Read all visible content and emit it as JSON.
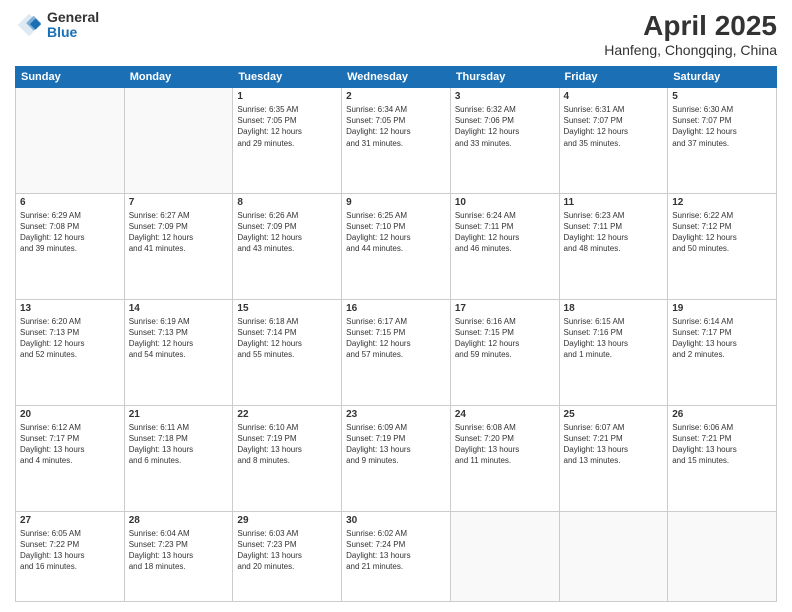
{
  "logo": {
    "general": "General",
    "blue": "Blue"
  },
  "header": {
    "month": "April 2025",
    "location": "Hanfeng, Chongqing, China"
  },
  "weekdays": [
    "Sunday",
    "Monday",
    "Tuesday",
    "Wednesday",
    "Thursday",
    "Friday",
    "Saturday"
  ],
  "weeks": [
    [
      {
        "day": "",
        "info": ""
      },
      {
        "day": "",
        "info": ""
      },
      {
        "day": "1",
        "info": "Sunrise: 6:35 AM\nSunset: 7:05 PM\nDaylight: 12 hours\nand 29 minutes."
      },
      {
        "day": "2",
        "info": "Sunrise: 6:34 AM\nSunset: 7:05 PM\nDaylight: 12 hours\nand 31 minutes."
      },
      {
        "day": "3",
        "info": "Sunrise: 6:32 AM\nSunset: 7:06 PM\nDaylight: 12 hours\nand 33 minutes."
      },
      {
        "day": "4",
        "info": "Sunrise: 6:31 AM\nSunset: 7:07 PM\nDaylight: 12 hours\nand 35 minutes."
      },
      {
        "day": "5",
        "info": "Sunrise: 6:30 AM\nSunset: 7:07 PM\nDaylight: 12 hours\nand 37 minutes."
      }
    ],
    [
      {
        "day": "6",
        "info": "Sunrise: 6:29 AM\nSunset: 7:08 PM\nDaylight: 12 hours\nand 39 minutes."
      },
      {
        "day": "7",
        "info": "Sunrise: 6:27 AM\nSunset: 7:09 PM\nDaylight: 12 hours\nand 41 minutes."
      },
      {
        "day": "8",
        "info": "Sunrise: 6:26 AM\nSunset: 7:09 PM\nDaylight: 12 hours\nand 43 minutes."
      },
      {
        "day": "9",
        "info": "Sunrise: 6:25 AM\nSunset: 7:10 PM\nDaylight: 12 hours\nand 44 minutes."
      },
      {
        "day": "10",
        "info": "Sunrise: 6:24 AM\nSunset: 7:11 PM\nDaylight: 12 hours\nand 46 minutes."
      },
      {
        "day": "11",
        "info": "Sunrise: 6:23 AM\nSunset: 7:11 PM\nDaylight: 12 hours\nand 48 minutes."
      },
      {
        "day": "12",
        "info": "Sunrise: 6:22 AM\nSunset: 7:12 PM\nDaylight: 12 hours\nand 50 minutes."
      }
    ],
    [
      {
        "day": "13",
        "info": "Sunrise: 6:20 AM\nSunset: 7:13 PM\nDaylight: 12 hours\nand 52 minutes."
      },
      {
        "day": "14",
        "info": "Sunrise: 6:19 AM\nSunset: 7:13 PM\nDaylight: 12 hours\nand 54 minutes."
      },
      {
        "day": "15",
        "info": "Sunrise: 6:18 AM\nSunset: 7:14 PM\nDaylight: 12 hours\nand 55 minutes."
      },
      {
        "day": "16",
        "info": "Sunrise: 6:17 AM\nSunset: 7:15 PM\nDaylight: 12 hours\nand 57 minutes."
      },
      {
        "day": "17",
        "info": "Sunrise: 6:16 AM\nSunset: 7:15 PM\nDaylight: 12 hours\nand 59 minutes."
      },
      {
        "day": "18",
        "info": "Sunrise: 6:15 AM\nSunset: 7:16 PM\nDaylight: 13 hours\nand 1 minute."
      },
      {
        "day": "19",
        "info": "Sunrise: 6:14 AM\nSunset: 7:17 PM\nDaylight: 13 hours\nand 2 minutes."
      }
    ],
    [
      {
        "day": "20",
        "info": "Sunrise: 6:12 AM\nSunset: 7:17 PM\nDaylight: 13 hours\nand 4 minutes."
      },
      {
        "day": "21",
        "info": "Sunrise: 6:11 AM\nSunset: 7:18 PM\nDaylight: 13 hours\nand 6 minutes."
      },
      {
        "day": "22",
        "info": "Sunrise: 6:10 AM\nSunset: 7:19 PM\nDaylight: 13 hours\nand 8 minutes."
      },
      {
        "day": "23",
        "info": "Sunrise: 6:09 AM\nSunset: 7:19 PM\nDaylight: 13 hours\nand 9 minutes."
      },
      {
        "day": "24",
        "info": "Sunrise: 6:08 AM\nSunset: 7:20 PM\nDaylight: 13 hours\nand 11 minutes."
      },
      {
        "day": "25",
        "info": "Sunrise: 6:07 AM\nSunset: 7:21 PM\nDaylight: 13 hours\nand 13 minutes."
      },
      {
        "day": "26",
        "info": "Sunrise: 6:06 AM\nSunset: 7:21 PM\nDaylight: 13 hours\nand 15 minutes."
      }
    ],
    [
      {
        "day": "27",
        "info": "Sunrise: 6:05 AM\nSunset: 7:22 PM\nDaylight: 13 hours\nand 16 minutes."
      },
      {
        "day": "28",
        "info": "Sunrise: 6:04 AM\nSunset: 7:23 PM\nDaylight: 13 hours\nand 18 minutes."
      },
      {
        "day": "29",
        "info": "Sunrise: 6:03 AM\nSunset: 7:23 PM\nDaylight: 13 hours\nand 20 minutes."
      },
      {
        "day": "30",
        "info": "Sunrise: 6:02 AM\nSunset: 7:24 PM\nDaylight: 13 hours\nand 21 minutes."
      },
      {
        "day": "",
        "info": ""
      },
      {
        "day": "",
        "info": ""
      },
      {
        "day": "",
        "info": ""
      }
    ]
  ]
}
